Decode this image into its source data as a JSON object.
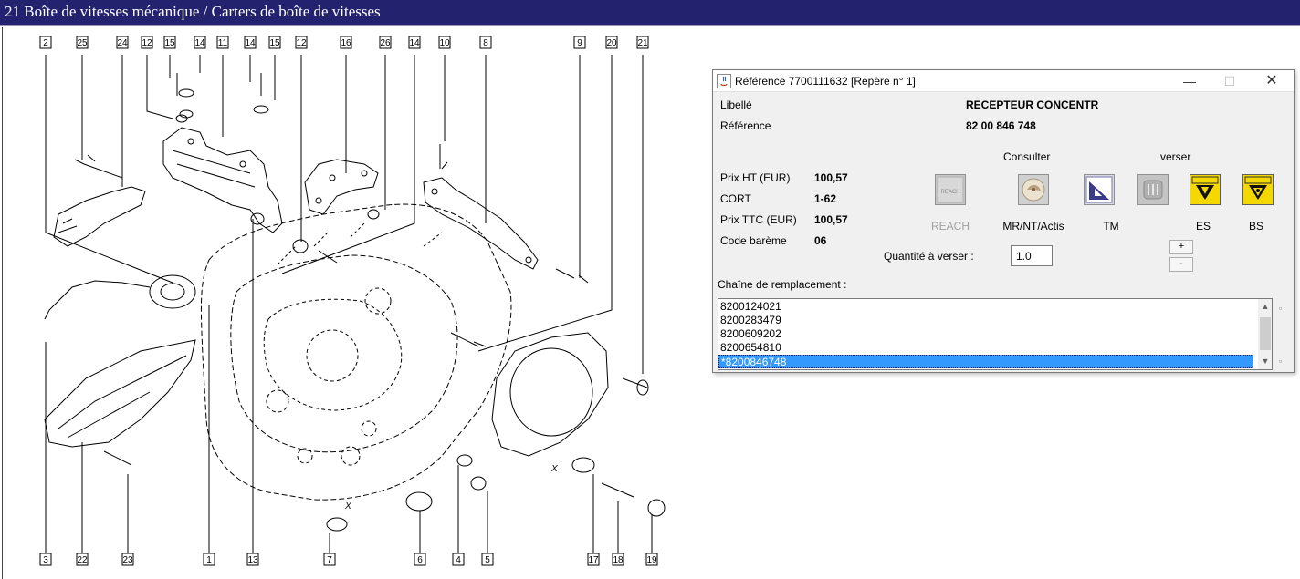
{
  "main_title": "21 Boîte de vitesses mécanique / Carters de boîte de vitesses",
  "diagram": {
    "top_callouts": [
      "2",
      "25",
      "24",
      "12",
      "15",
      "14",
      "11",
      "14",
      "15",
      "12",
      "16",
      "26",
      "14",
      "10",
      "8",
      "9",
      "20",
      "21"
    ],
    "bottom_callouts": [
      "3",
      "22",
      "23",
      "1",
      "13",
      "7",
      "6",
      "4",
      "5",
      "17",
      "18",
      "19"
    ],
    "dimension_marks": [
      "X",
      "X"
    ]
  },
  "dialog": {
    "title": "Référence 7700111632 [Repère n° 1]",
    "buttons": {
      "minimize": "—",
      "maximize": "☐",
      "close": "✕"
    },
    "libelle_label": "Libellé",
    "libelle_value": "RECEPTEUR CONCENTR",
    "reference_label": "Référence",
    "reference_value": "82 00 846 748",
    "consulter_label": "Consulter",
    "verser_label": "verser",
    "prix_ht_label": "Prix HT (EUR)",
    "prix_ht_value": "100,57",
    "cort_label": "CORT",
    "cort_value": "1-62",
    "prix_ttc_label": "Prix TTC (EUR)",
    "prix_ttc_value": "100,57",
    "code_bareme_label": "Code barème",
    "code_bareme_value": "06",
    "icons": [
      {
        "name": "reach-icon",
        "caption": "REACH",
        "enabled": false
      },
      {
        "name": "mr-nt-actis-icon",
        "caption": "MR/NT/Actis",
        "enabled": true
      },
      {
        "name": "tm-icon",
        "caption": "TM",
        "enabled": true
      },
      {
        "name": "document-icon",
        "caption": "",
        "enabled": false
      },
      {
        "name": "es-icon",
        "caption": "ES",
        "enabled": true
      },
      {
        "name": "bs-icon",
        "caption": "BS",
        "enabled": true
      }
    ],
    "reach_icon_text": "REACH",
    "quantite_label": "Quantité à verser :",
    "quantite_value": "1.0",
    "plus_label": "+",
    "minus_label": "-",
    "chaine_label": "Chaîne de remplacement :",
    "chaine_items": [
      "8200124021",
      "8200283479",
      "8200609202",
      "8200654810",
      "*8200846748"
    ],
    "selected_index": 4
  },
  "colors": {
    "title_bar": "#22226e",
    "selection": "#3399ff",
    "es_bs_yellow": "#f5d800"
  }
}
